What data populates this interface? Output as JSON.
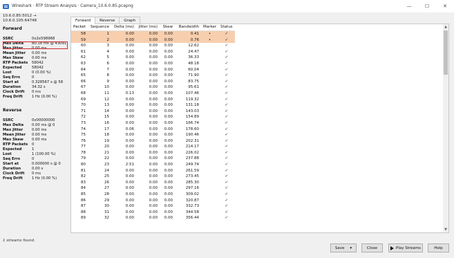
{
  "window": {
    "title": "Wireshark · RTP Stream Analysis · Camera_10.6.0.85.pcapng",
    "minimize": "—",
    "maximize": "☐",
    "close": "✕"
  },
  "forward": {
    "ep1": "10.6.0.85:5012 →",
    "ep2": "10.6.0.105:64748",
    "heading": "Forward",
    "stats": [
      {
        "k": "SSRC",
        "v": "0x2e598968"
      },
      {
        "k": "Max Delta",
        "v": "80.18 ms @ 43091"
      },
      {
        "k": "Max Jitter",
        "v": "0.00 ms"
      },
      {
        "k": "Mean Jitter",
        "v": "0.00 ms"
      },
      {
        "k": "Max Skew",
        "v": "0.00 ms"
      },
      {
        "k": "RTP Packets",
        "v": "58042"
      },
      {
        "k": "Expected",
        "v": "58042"
      },
      {
        "k": "Lost",
        "v": "0 (0.00 %)"
      },
      {
        "k": "Seq Errs",
        "v": "0"
      },
      {
        "k": "Start at",
        "v": "0.328567 s @ 58"
      },
      {
        "k": "Duration",
        "v": "34.32 s"
      },
      {
        "k": "Clock Drift",
        "v": "0 ms"
      },
      {
        "k": "Freq Drift",
        "v": "1 Hz (0.00 %)"
      }
    ]
  },
  "reverse": {
    "heading": "Reverse",
    "stats": [
      {
        "k": "SSRC",
        "v": "0x00000000"
      },
      {
        "k": "Max Delta",
        "v": "0.00 ms @ 0"
      },
      {
        "k": "Max Jitter",
        "v": "0.00 ms"
      },
      {
        "k": "Mean Jitter",
        "v": "0.00 ms"
      },
      {
        "k": "Max Skew",
        "v": "0.00 ms"
      },
      {
        "k": "RTP Packets",
        "v": "0"
      },
      {
        "k": "Expected",
        "v": "1"
      },
      {
        "k": "Lost",
        "v": "1 (100.00 %)"
      },
      {
        "k": "Seq Errs",
        "v": "0"
      },
      {
        "k": "Start at",
        "v": "0.000000 s @ 0"
      },
      {
        "k": "Duration",
        "v": "0.00 s"
      },
      {
        "k": "Clock Drift",
        "v": "0 ms"
      },
      {
        "k": "Freq Drift",
        "v": "1 Hz (0.00 %)"
      }
    ]
  },
  "tabs": [
    "Forward",
    "Reverse",
    "Graph"
  ],
  "table": {
    "headers": [
      "Packet",
      "Sequence",
      "Delta (ms)",
      "Jitter (ms)",
      "Skew",
      "Bandwidth",
      "Marker",
      "Status"
    ],
    "rows": [
      [
        "58",
        "1",
        "0.00",
        "0.00",
        "0.00",
        "0.41",
        "•",
        "✓"
      ],
      [
        "59",
        "2",
        "0.00",
        "0.00",
        "0.00",
        "0.76",
        "•",
        "✓"
      ],
      [
        "60",
        "3",
        "0.00",
        "0.00",
        "0.00",
        "12.62",
        "",
        "✓"
      ],
      [
        "61",
        "4",
        "0.00",
        "0.00",
        "0.00",
        "24.47",
        "",
        "✓"
      ],
      [
        "62",
        "5",
        "0.00",
        "0.00",
        "0.00",
        "36.33",
        "",
        "✓"
      ],
      [
        "63",
        "6",
        "0.00",
        "0.00",
        "0.00",
        "48.18",
        "",
        "✓"
      ],
      [
        "64",
        "7",
        "0.00",
        "0.00",
        "0.00",
        "60.04",
        "",
        "✓"
      ],
      [
        "65",
        "8",
        "0.00",
        "0.00",
        "0.00",
        "71.90",
        "",
        "✓"
      ],
      [
        "66",
        "9",
        "0.00",
        "0.00",
        "0.00",
        "83.75",
        "",
        "✓"
      ],
      [
        "67",
        "10",
        "0.00",
        "0.00",
        "0.00",
        "95.61",
        "",
        "✓"
      ],
      [
        "68",
        "11",
        "0.13",
        "0.00",
        "0.00",
        "107.46",
        "",
        "✓"
      ],
      [
        "69",
        "12",
        "0.00",
        "0.00",
        "0.00",
        "119.32",
        "",
        "✓"
      ],
      [
        "70",
        "13",
        "0.00",
        "0.00",
        "0.00",
        "131.18",
        "",
        "✓"
      ],
      [
        "71",
        "14",
        "0.00",
        "0.00",
        "0.00",
        "143.03",
        "",
        "✓"
      ],
      [
        "72",
        "15",
        "0.00",
        "0.00",
        "0.00",
        "154.89",
        "",
        "✓"
      ],
      [
        "73",
        "16",
        "0.00",
        "0.00",
        "0.00",
        "166.74",
        "",
        "✓"
      ],
      [
        "74",
        "17",
        "0.06",
        "0.00",
        "0.00",
        "178.60",
        "",
        "✓"
      ],
      [
        "75",
        "18",
        "0.00",
        "0.00",
        "0.00",
        "190.46",
        "",
        "✓"
      ],
      [
        "76",
        "19",
        "0.00",
        "0.00",
        "0.00",
        "202.31",
        "",
        "✓"
      ],
      [
        "77",
        "20",
        "0.00",
        "0.00",
        "0.00",
        "214.17",
        "",
        "✓"
      ],
      [
        "78",
        "21",
        "0.00",
        "0.00",
        "0.00",
        "226.02",
        "",
        "✓"
      ],
      [
        "79",
        "22",
        "0.00",
        "0.00",
        "0.00",
        "237.88",
        "",
        "✓"
      ],
      [
        "80",
        "23",
        "2.51",
        "0.00",
        "0.00",
        "249.74",
        "",
        "✓"
      ],
      [
        "81",
        "24",
        "0.00",
        "0.00",
        "0.00",
        "261.59",
        "",
        "✓"
      ],
      [
        "82",
        "25",
        "0.00",
        "0.00",
        "0.00",
        "273.45",
        "",
        "✓"
      ],
      [
        "83",
        "26",
        "0.00",
        "0.00",
        "0.00",
        "285.30",
        "",
        "✓"
      ],
      [
        "84",
        "27",
        "0.00",
        "0.00",
        "0.00",
        "297.16",
        "",
        "✓"
      ],
      [
        "85",
        "28",
        "0.00",
        "0.00",
        "0.00",
        "309.02",
        "",
        "✓"
      ],
      [
        "86",
        "29",
        "0.00",
        "0.00",
        "0.00",
        "320.87",
        "",
        "✓"
      ],
      [
        "87",
        "30",
        "0.00",
        "0.00",
        "0.00",
        "332.73",
        "",
        "✓"
      ],
      [
        "88",
        "31",
        "0.00",
        "0.00",
        "0.00",
        "344.58",
        "",
        "✓"
      ],
      [
        "89",
        "32",
        "0.00",
        "0.00",
        "0.00",
        "356.44",
        "",
        "✓"
      ]
    ]
  },
  "footer": {
    "status": "1 streams found.",
    "save": "Save",
    "dropdown_arrow": "▾",
    "close": "Close",
    "play": "Play Streams",
    "help": "Help"
  }
}
